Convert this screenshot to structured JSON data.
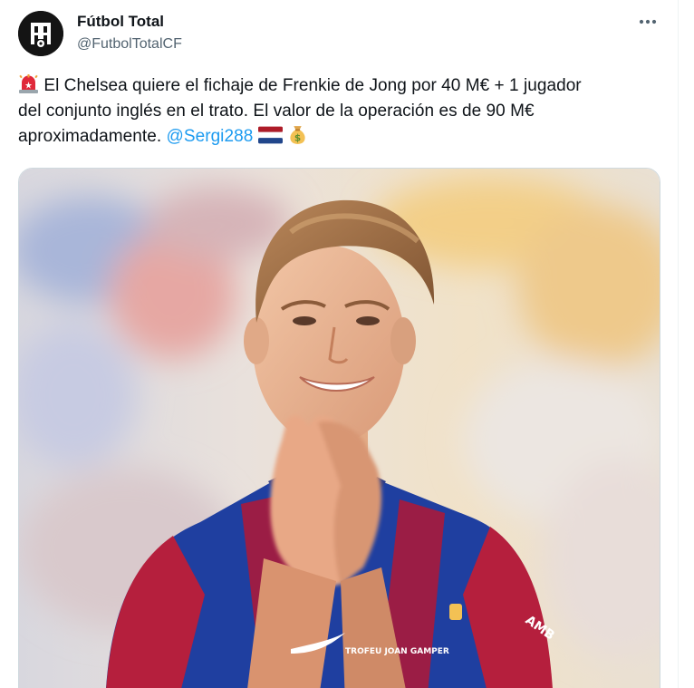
{
  "author": {
    "display_name": "Fútbol Total",
    "handle": "@FutbolTotalCF",
    "avatar_icon": "futbol-total-logo"
  },
  "menu": {
    "icon": "more-horizontal-icon"
  },
  "tweet": {
    "emoji_start": "siren-emoji",
    "line1": "El Chelsea quiere el fichaje de Frenkie de Jong por 40 M€ + 1 jugador",
    "line2": "del conjunto inglés en el trato. El valor de la operación es de 90 M€",
    "line3": "aproximadamente.",
    "mention": "@Sergi288",
    "emoji_end": [
      "netherlands-flag-emoji",
      "money-bag-emoji"
    ]
  },
  "media": {
    "type": "photo",
    "jersey_sponsor_text": "AMB",
    "jersey_badge_text": "TROFEU JOAN GAMPER"
  },
  "colors": {
    "text": "#0f1419",
    "secondary": "#536471",
    "link": "#1d9bf0",
    "border": "#cfd9de"
  }
}
